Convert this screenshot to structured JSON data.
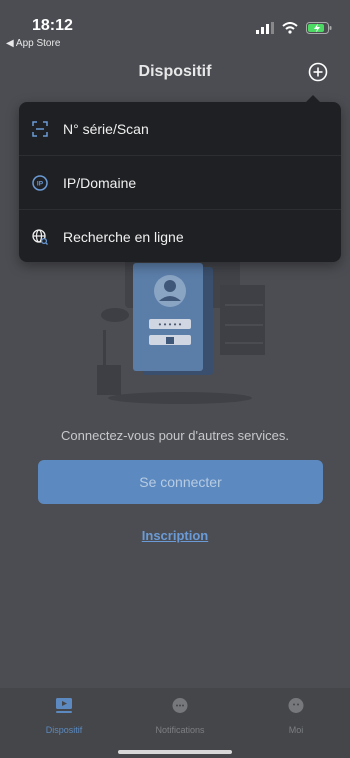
{
  "status_bar": {
    "time": "18:12",
    "back_app": "◀ App Store"
  },
  "nav": {
    "title": "Dispositif"
  },
  "dropdown": {
    "items": [
      {
        "label": "N° série/Scan",
        "icon": "scan-icon"
      },
      {
        "label": "IP/Domaine",
        "icon": "ip-icon"
      },
      {
        "label": "Recherche en ligne",
        "icon": "globe-search-icon"
      }
    ]
  },
  "main": {
    "hint": "Connectez-vous pour d'autres services.",
    "login_label": "Se connecter",
    "signup_label": "Inscription"
  },
  "tabs": [
    {
      "label": "Dispositif",
      "icon": "device-icon",
      "active": true
    },
    {
      "label": "Notifications",
      "icon": "chat-icon",
      "active": false
    },
    {
      "label": "Moi",
      "icon": "profile-icon",
      "active": false
    }
  ],
  "colors": {
    "background": "#4b4d52",
    "accent": "#5c8ac0",
    "menu_bg": "#1f2023"
  }
}
